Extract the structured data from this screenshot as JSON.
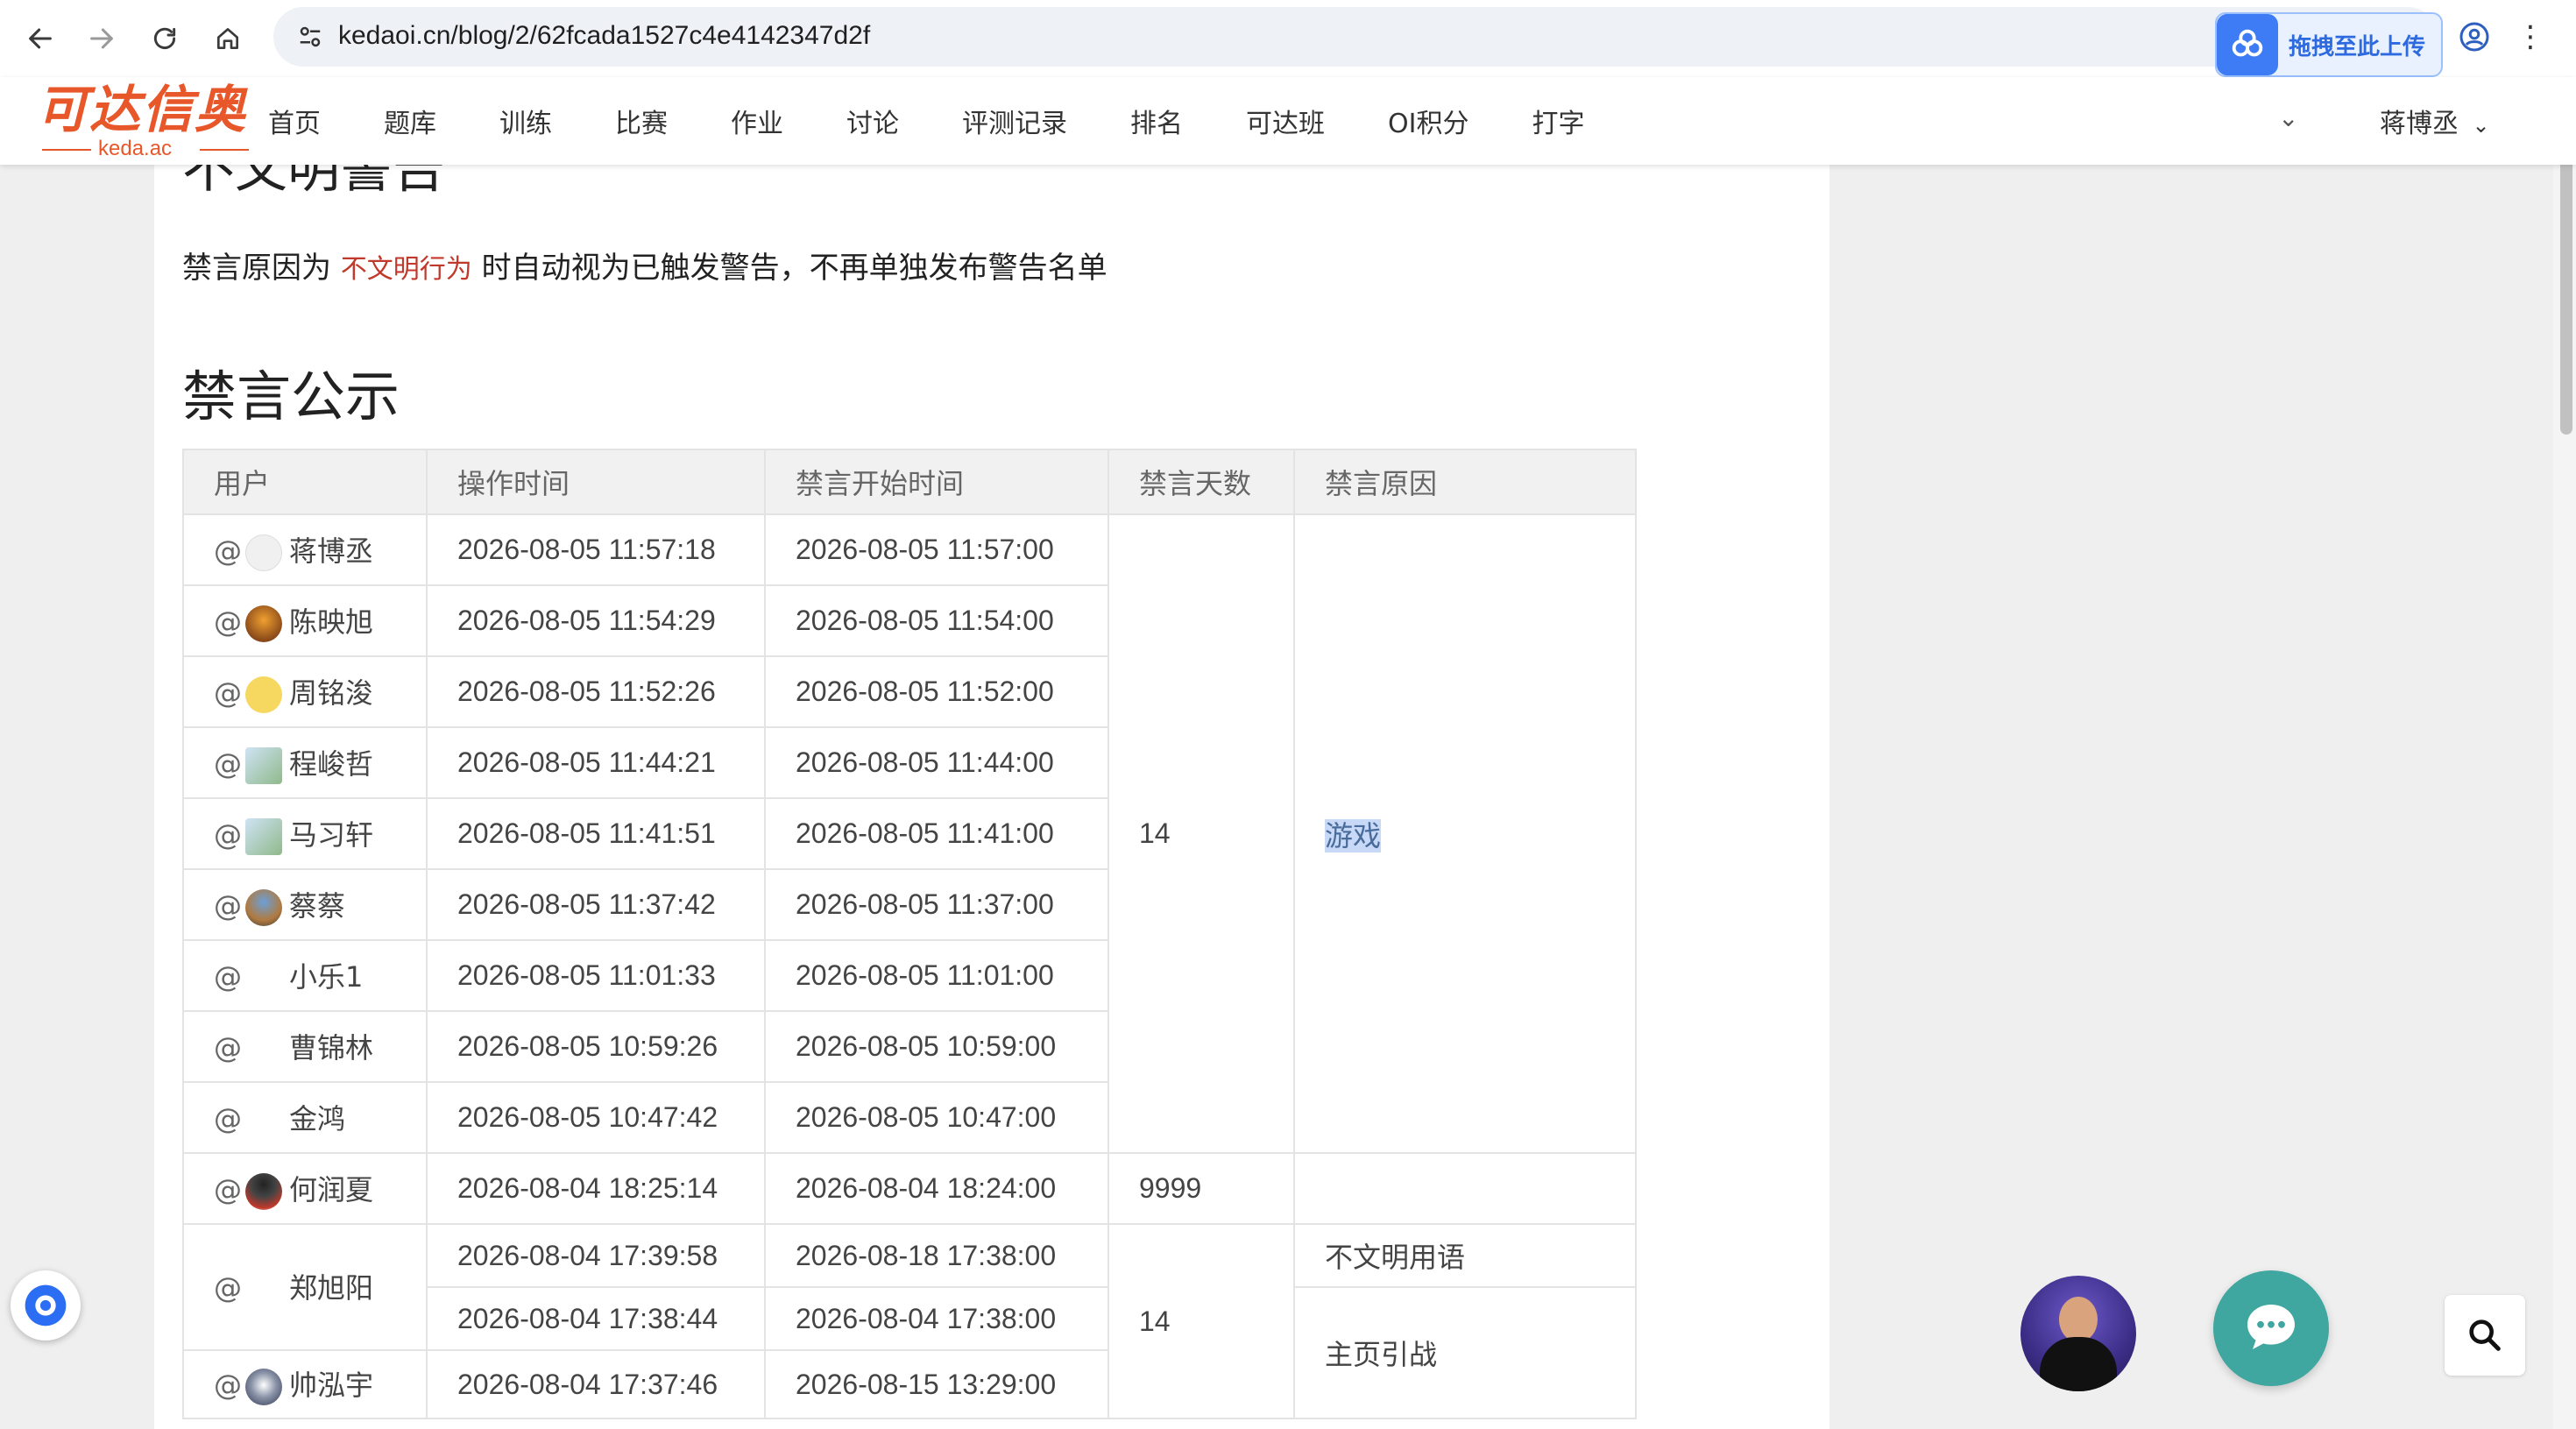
{
  "browser": {
    "url": "kedaoi.cn/blog/2/62fcada1527c4e4142347d2f",
    "upload_extension_label": "拖拽至此上传"
  },
  "site": {
    "logo_text": "可达信奥",
    "logo_sub": "keda.ac",
    "nav": [
      "首页",
      "题库",
      "训练",
      "比赛",
      "作业",
      "讨论",
      "评测记录",
      "排名",
      "可达班",
      "OI积分",
      "打字"
    ],
    "user_name": "蒋博丞"
  },
  "article": {
    "clipped_heading": "不文明警告",
    "notice_before": "禁言原因为 ",
    "notice_highlight": "不文明行为",
    "notice_after": " 时自动视为已触发警告，不再单独发布警告名单",
    "section_title": "禁言公示"
  },
  "table": {
    "headers": [
      "用户",
      "操作时间",
      "禁言开始时间",
      "禁言天数",
      "禁言原因"
    ],
    "rows": [
      {
        "user": "蒋博丞",
        "op_time": "2026-08-05 11:57:18",
        "start_time": "2026-08-05 11:57:00"
      },
      {
        "user": "陈映旭",
        "op_time": "2026-08-05 11:54:29",
        "start_time": "2026-08-05 11:54:00"
      },
      {
        "user": "周铭浚",
        "op_time": "2026-08-05 11:52:26",
        "start_time": "2026-08-05 11:52:00"
      },
      {
        "user": "程峻哲",
        "op_time": "2026-08-05 11:44:21",
        "start_time": "2026-08-05 11:44:00"
      },
      {
        "user": "马习轩",
        "op_time": "2026-08-05 11:41:51",
        "start_time": "2026-08-05 11:41:00"
      },
      {
        "user": "蔡蔡",
        "op_time": "2026-08-05 11:37:42",
        "start_time": "2026-08-05 11:37:00"
      },
      {
        "user": "小乐1",
        "op_time": "2026-08-05 11:01:33",
        "start_time": "2026-08-05 11:01:00"
      },
      {
        "user": "曹锦林",
        "op_time": "2026-08-05 10:59:26",
        "start_time": "2026-08-05 10:59:00"
      },
      {
        "user": "金鸿",
        "op_time": "2026-08-05 10:47:42",
        "start_time": "2026-08-05 10:47:00"
      },
      {
        "user": "何润夏",
        "op_time": "2026-08-04 18:25:14",
        "start_time": "2026-08-04 18:24:00"
      },
      {
        "user": "郑旭阳",
        "op_time": "2026-08-04 17:39:58",
        "start_time": "2026-08-18 17:38:00"
      },
      {
        "op_time": "2026-08-04 17:38:44",
        "start_time": "2026-08-04 17:38:00"
      },
      {
        "user": "帅泓宇",
        "op_time": "2026-08-04 17:37:46",
        "start_time": "2026-08-15 13:29:00"
      }
    ],
    "group1_days": "14",
    "group1_reason": "游戏",
    "row10_days": "9999",
    "group2_days": "14",
    "reason_a": "不文明用语",
    "reason_b": "主页引战"
  },
  "colors": {
    "brand": "#e8572a",
    "highlight_text": "#c0392b",
    "selection": "#c7d9f7",
    "chat": "#3fa6a0"
  }
}
